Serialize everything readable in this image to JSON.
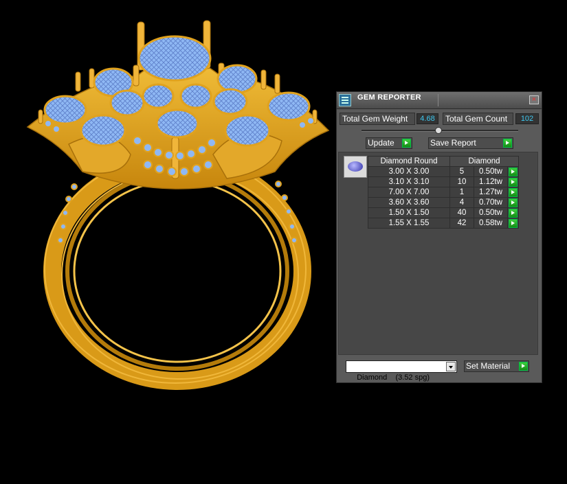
{
  "panel": {
    "title": "GEM REPORTER",
    "total_gem_weight_label": "Total Gem Weight",
    "total_gem_weight_value": "4.68",
    "total_gem_count_label": "Total Gem Count",
    "total_gem_count_value": "102",
    "update_label": "Update",
    "save_report_label": "Save Report",
    "table": {
      "shape_header": "Diamond Round",
      "material_header": "Diamond",
      "rows": [
        {
          "size": "3.00 X 3.00",
          "count": "5",
          "weight": "0.50tw"
        },
        {
          "size": "3.10 X 3.10",
          "count": "10",
          "weight": "1.12tw"
        },
        {
          "size": "7.00 X 7.00",
          "count": "1",
          "weight": "1.27tw"
        },
        {
          "size": "3.60 X 3.60",
          "count": "4",
          "weight": "0.70tw"
        },
        {
          "size": "1.50 X 1.50",
          "count": "40",
          "weight": "0.50tw"
        },
        {
          "size": "1.55 X 1.55",
          "count": "42",
          "weight": "0.58tw"
        }
      ]
    },
    "material_select": "Diamond    (3.52 spg)",
    "set_material_label": "Set Material"
  },
  "colors": {
    "metal": "#e0a21e",
    "gem": "#8fb8f4",
    "value_text": "#3ec8f0",
    "panel_bg": "#5a5a5a"
  }
}
